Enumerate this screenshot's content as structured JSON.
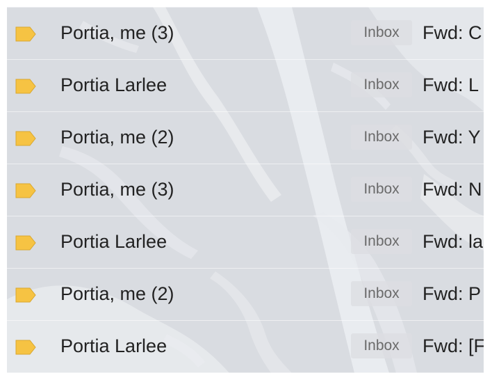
{
  "threads": [
    {
      "sender": "Portia, me (3)",
      "label": "Inbox",
      "subject": "Fwd: C"
    },
    {
      "sender": "Portia Larlee",
      "label": "Inbox",
      "subject": "Fwd: L"
    },
    {
      "sender": "Portia, me (2)",
      "label": "Inbox",
      "subject": "Fwd: Y"
    },
    {
      "sender": "Portia, me (3)",
      "label": "Inbox",
      "subject": "Fwd: N"
    },
    {
      "sender": "Portia Larlee",
      "label": "Inbox",
      "subject": "Fwd: la"
    },
    {
      "sender": "Portia, me (2)",
      "label": "Inbox",
      "subject": "Fwd: P"
    },
    {
      "sender": "Portia Larlee",
      "label": "Inbox",
      "subject": "Fwd: [F"
    }
  ],
  "icons": {
    "importance_marker": "label-importance-icon"
  },
  "colors": {
    "importance_marker": "#f6c343",
    "chip_background": "#dcdee1",
    "chip_text": "#6a6a6a",
    "text": "#222222"
  }
}
